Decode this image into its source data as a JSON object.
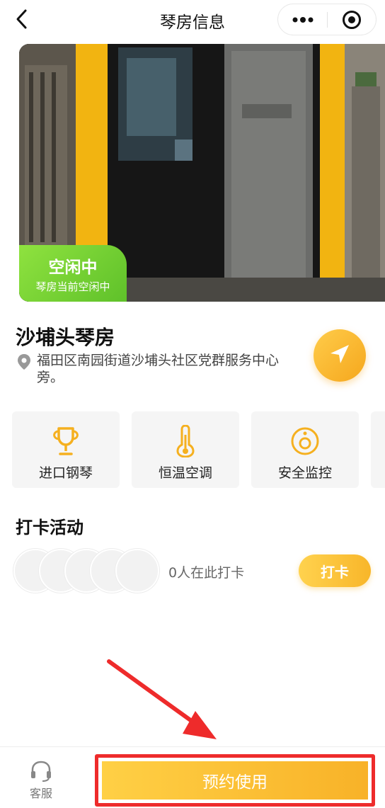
{
  "navbar": {
    "title": "琴房信息",
    "back_icon": "chevron-left-icon",
    "more_icon": "more-dots-icon",
    "close_icon": "target-close-icon"
  },
  "hero": {
    "status_title": "空闲中",
    "status_subtitle": "琴房当前空闲中",
    "status_color": "#6fcf30"
  },
  "room": {
    "name": "沙埔头琴房",
    "address": "福田区南园街道沙埔头社区党群服务中心旁。",
    "location_icon": "map-pin-icon",
    "navigate_icon": "navigation-arrow-icon"
  },
  "features": [
    {
      "label": "进口钢琴",
      "icon": "trophy-icon"
    },
    {
      "label": "恒温空调",
      "icon": "thermometer-icon"
    },
    {
      "label": "安全监控",
      "icon": "camera-icon"
    }
  ],
  "checkin": {
    "title": "打卡活动",
    "count_text": "0人在此打卡",
    "button_label": "打卡"
  },
  "bottom_bar": {
    "service_label": "客服",
    "service_icon": "headset-icon",
    "reserve_label": "预约使用",
    "highlight_color": "#ee2b2b"
  },
  "colors": {
    "accent": "#f8b62a",
    "accent_light": "#ffd24e"
  }
}
